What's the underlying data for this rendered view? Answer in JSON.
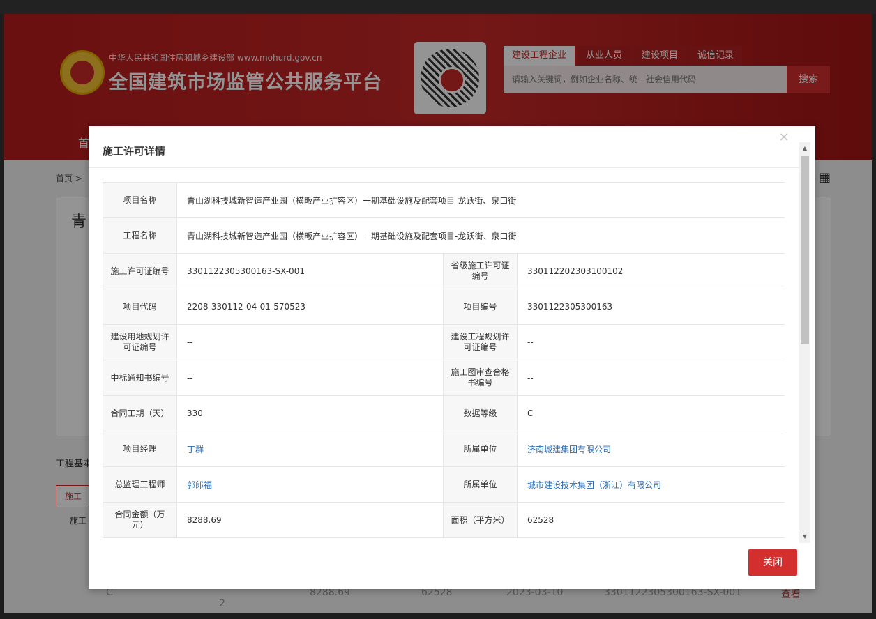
{
  "header": {
    "subtitle": "中华人民共和国住房和城乡建设部  www.mohurd.gov.cn",
    "title": "全国建筑市场监管公共服务平台",
    "tabs": [
      "建设工程企业",
      "从业人员",
      "建设项目",
      "诚信记录"
    ],
    "search_placeholder": "请输入关键词，例如企业名称、统一社会信用代码",
    "search_button": "搜索",
    "nav_home": "首"
  },
  "background": {
    "breadcrumb": "首页 >",
    "title_fragment": "青",
    "section_label": "工程基本",
    "tab_label": "施工",
    "tab2_label": "施工",
    "row": {
      "grade": "C",
      "code_tail": "2",
      "amount": "8288.69",
      "area": "62528",
      "date": "2023-03-10",
      "permit": "3301122305300163-SX-001",
      "view": "查看"
    }
  },
  "modal": {
    "title": "施工许可详情",
    "close_label": "关闭",
    "close_x": "×",
    "rows": [
      {
        "label": "项目名称",
        "value": "青山湖科技城新智造产业园（横畈产业扩容区）一期基础设施及配套项目-龙跃街、泉口街"
      },
      {
        "label": "工程名称",
        "value": "青山湖科技城新智造产业园（横畈产业扩容区）一期基础设施及配套项目-龙跃街、泉口街"
      }
    ],
    "pairs": [
      {
        "l1": "施工许可证编号",
        "v1": "3301122305300163-SX-001",
        "l2": "省级施工许可证编号",
        "v2": "330112202303100102"
      },
      {
        "l1": "项目代码",
        "v1": "2208-330112-04-01-570523",
        "l2": "项目编号",
        "v2": "3301122305300163"
      },
      {
        "l1": "建设用地规划许可证编号",
        "v1": "--",
        "l2": "建设工程规划许可证编号",
        "v2": "--"
      },
      {
        "l1": "中标通知书编号",
        "v1": "--",
        "l2": "施工图审查合格书编号",
        "v2": "--"
      },
      {
        "l1": "合同工期（天）",
        "v1": "330",
        "l2": "数据等级",
        "v2": "C"
      },
      {
        "l1": "项目经理",
        "v1": "丁群",
        "l2": "所属单位",
        "v2": "济南城建集团有限公司"
      },
      {
        "l1": "总监理工程师",
        "v1": "郭郎福",
        "l2": "所属单位",
        "v2": "城市建设技术集团（浙江）有限公司"
      },
      {
        "l1": "合同金额（万元）",
        "v1": "8288.69",
        "l2": "面积（平方米）",
        "v2": "62528"
      }
    ]
  }
}
